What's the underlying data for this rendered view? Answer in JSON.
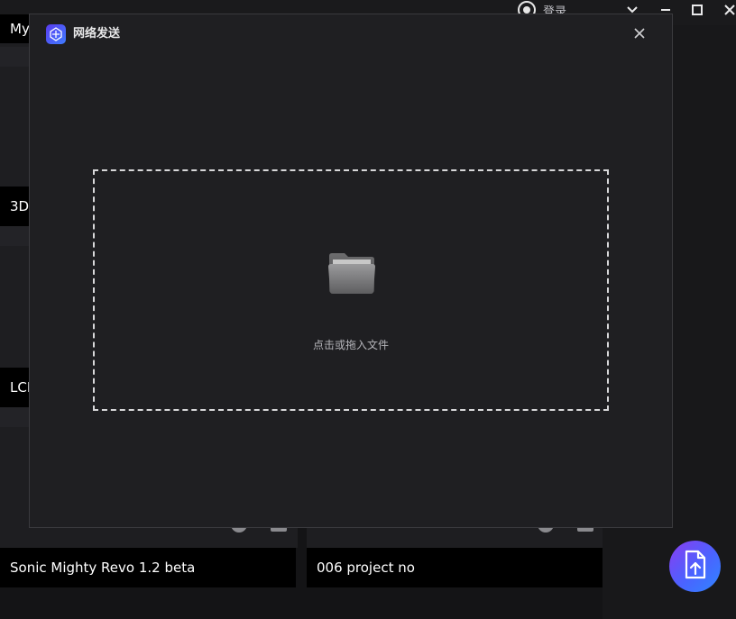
{
  "topbar": {
    "login_label": "登录",
    "controls": [
      {
        "name": "dropdown-icon",
        "glyph": "⌄"
      },
      {
        "name": "minimize-icon",
        "glyph": "—"
      },
      {
        "name": "maximize-icon",
        "glyph": "☐"
      },
      {
        "name": "close-icon",
        "glyph": "✕"
      }
    ]
  },
  "background": {
    "cards": [
      {
        "label": "My"
      },
      {
        "label": "3D"
      },
      {
        "label": "LCI"
      },
      {
        "label": "Sonic Mighty Revo 1.2 beta"
      },
      {
        "label": "006 project no"
      }
    ]
  },
  "dialog": {
    "title": "网络发送",
    "dropzone_text": "点击或拖入文件",
    "close_icon": "close-icon",
    "folder_icon": "folder-icon"
  },
  "fab": {
    "icon": "upload-file-icon"
  },
  "colors": {
    "accent_start": "#8a3cf0",
    "accent_end": "#2f86ff",
    "dialog_bg": "#1f1f22",
    "app_bg": "#141416"
  }
}
